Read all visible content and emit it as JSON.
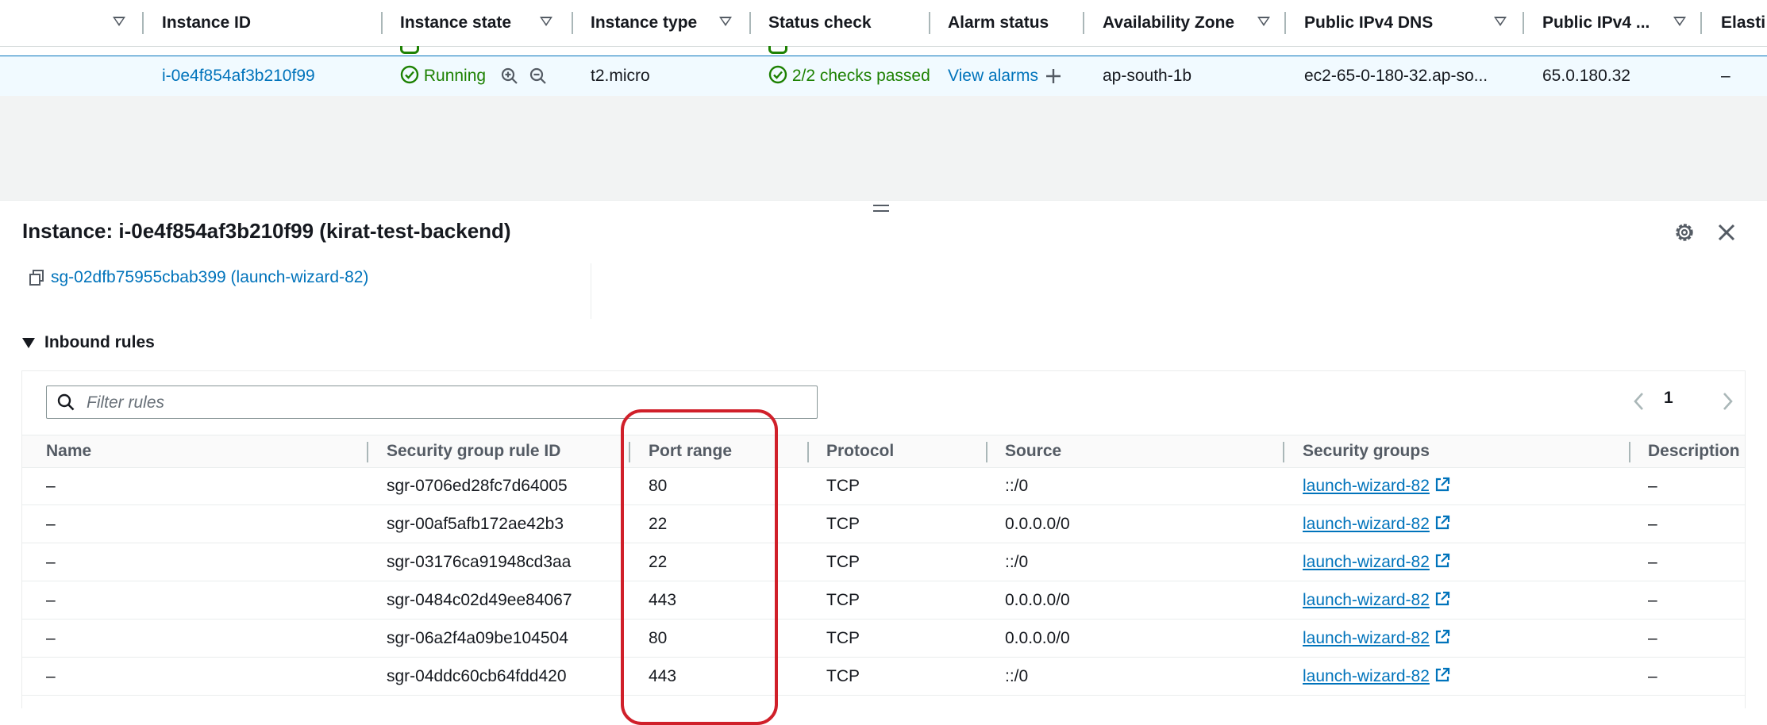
{
  "instances_table": {
    "columns": [
      {
        "key": "instance_id",
        "label": "Instance ID"
      },
      {
        "key": "instance_state",
        "label": "Instance state"
      },
      {
        "key": "instance_type",
        "label": "Instance type"
      },
      {
        "key": "status_check",
        "label": "Status check"
      },
      {
        "key": "alarm_status",
        "label": "Alarm status"
      },
      {
        "key": "availability_zone",
        "label": "Availability Zone"
      },
      {
        "key": "public_ipv4_dns",
        "label": "Public IPv4 DNS"
      },
      {
        "key": "public_ipv4",
        "label": "Public IPv4 ..."
      },
      {
        "key": "elastic",
        "label": "Elasti"
      }
    ],
    "selected_row": {
      "instance_id": "i-0e4f854af3b210f99",
      "instance_state": "Running",
      "instance_type": "t2.micro",
      "status_check": "2/2 checks passed",
      "alarm_status": "View alarms",
      "availability_zone": "ap-south-1b",
      "public_ipv4_dns": "ec2-65-0-180-32.ap-so...",
      "public_ipv4": "65.0.180.32",
      "elastic": "–"
    }
  },
  "detail": {
    "title": "Instance: i-0e4f854af3b210f99 (kirat-test-backend)",
    "security_group_link": "sg-02dfb75955cbab399 (launch-wizard-82)",
    "inbound_rules_label": "Inbound rules",
    "filter_placeholder": "Filter rules",
    "pagination_page": "1",
    "rules_columns": {
      "name": "Name",
      "rule_id": "Security group rule ID",
      "port_range": "Port range",
      "protocol": "Protocol",
      "source": "Source",
      "security_groups": "Security groups",
      "description": "Description"
    },
    "rules": [
      {
        "name": "–",
        "rule_id": "sgr-0706ed28fc7d64005",
        "port_range": "80",
        "protocol": "TCP",
        "source": "::/0",
        "security_groups": "launch-wizard-82",
        "description": "–"
      },
      {
        "name": "–",
        "rule_id": "sgr-00af5afb172ae42b3",
        "port_range": "22",
        "protocol": "TCP",
        "source": "0.0.0.0/0",
        "security_groups": "launch-wizard-82",
        "description": "–"
      },
      {
        "name": "–",
        "rule_id": "sgr-03176ca91948cd3aa",
        "port_range": "22",
        "protocol": "TCP",
        "source": "::/0",
        "security_groups": "launch-wizard-82",
        "description": "–"
      },
      {
        "name": "–",
        "rule_id": "sgr-0484c02d49ee84067",
        "port_range": "443",
        "protocol": "TCP",
        "source": "0.0.0.0/0",
        "security_groups": "launch-wizard-82",
        "description": "–"
      },
      {
        "name": "–",
        "rule_id": "sgr-06a2f4a09be104504",
        "port_range": "80",
        "protocol": "TCP",
        "source": "0.0.0.0/0",
        "security_groups": "launch-wizard-82",
        "description": "–"
      },
      {
        "name": "–",
        "rule_id": "sgr-04ddc60cb64fdd420",
        "port_range": "443",
        "protocol": "TCP",
        "source": "::/0",
        "security_groups": "launch-wizard-82",
        "description": "–"
      }
    ]
  },
  "colors": {
    "link": "#0073bb",
    "success": "#1d8102",
    "selected_row_bg": "#f1faff",
    "annotation": "#d0202a"
  }
}
